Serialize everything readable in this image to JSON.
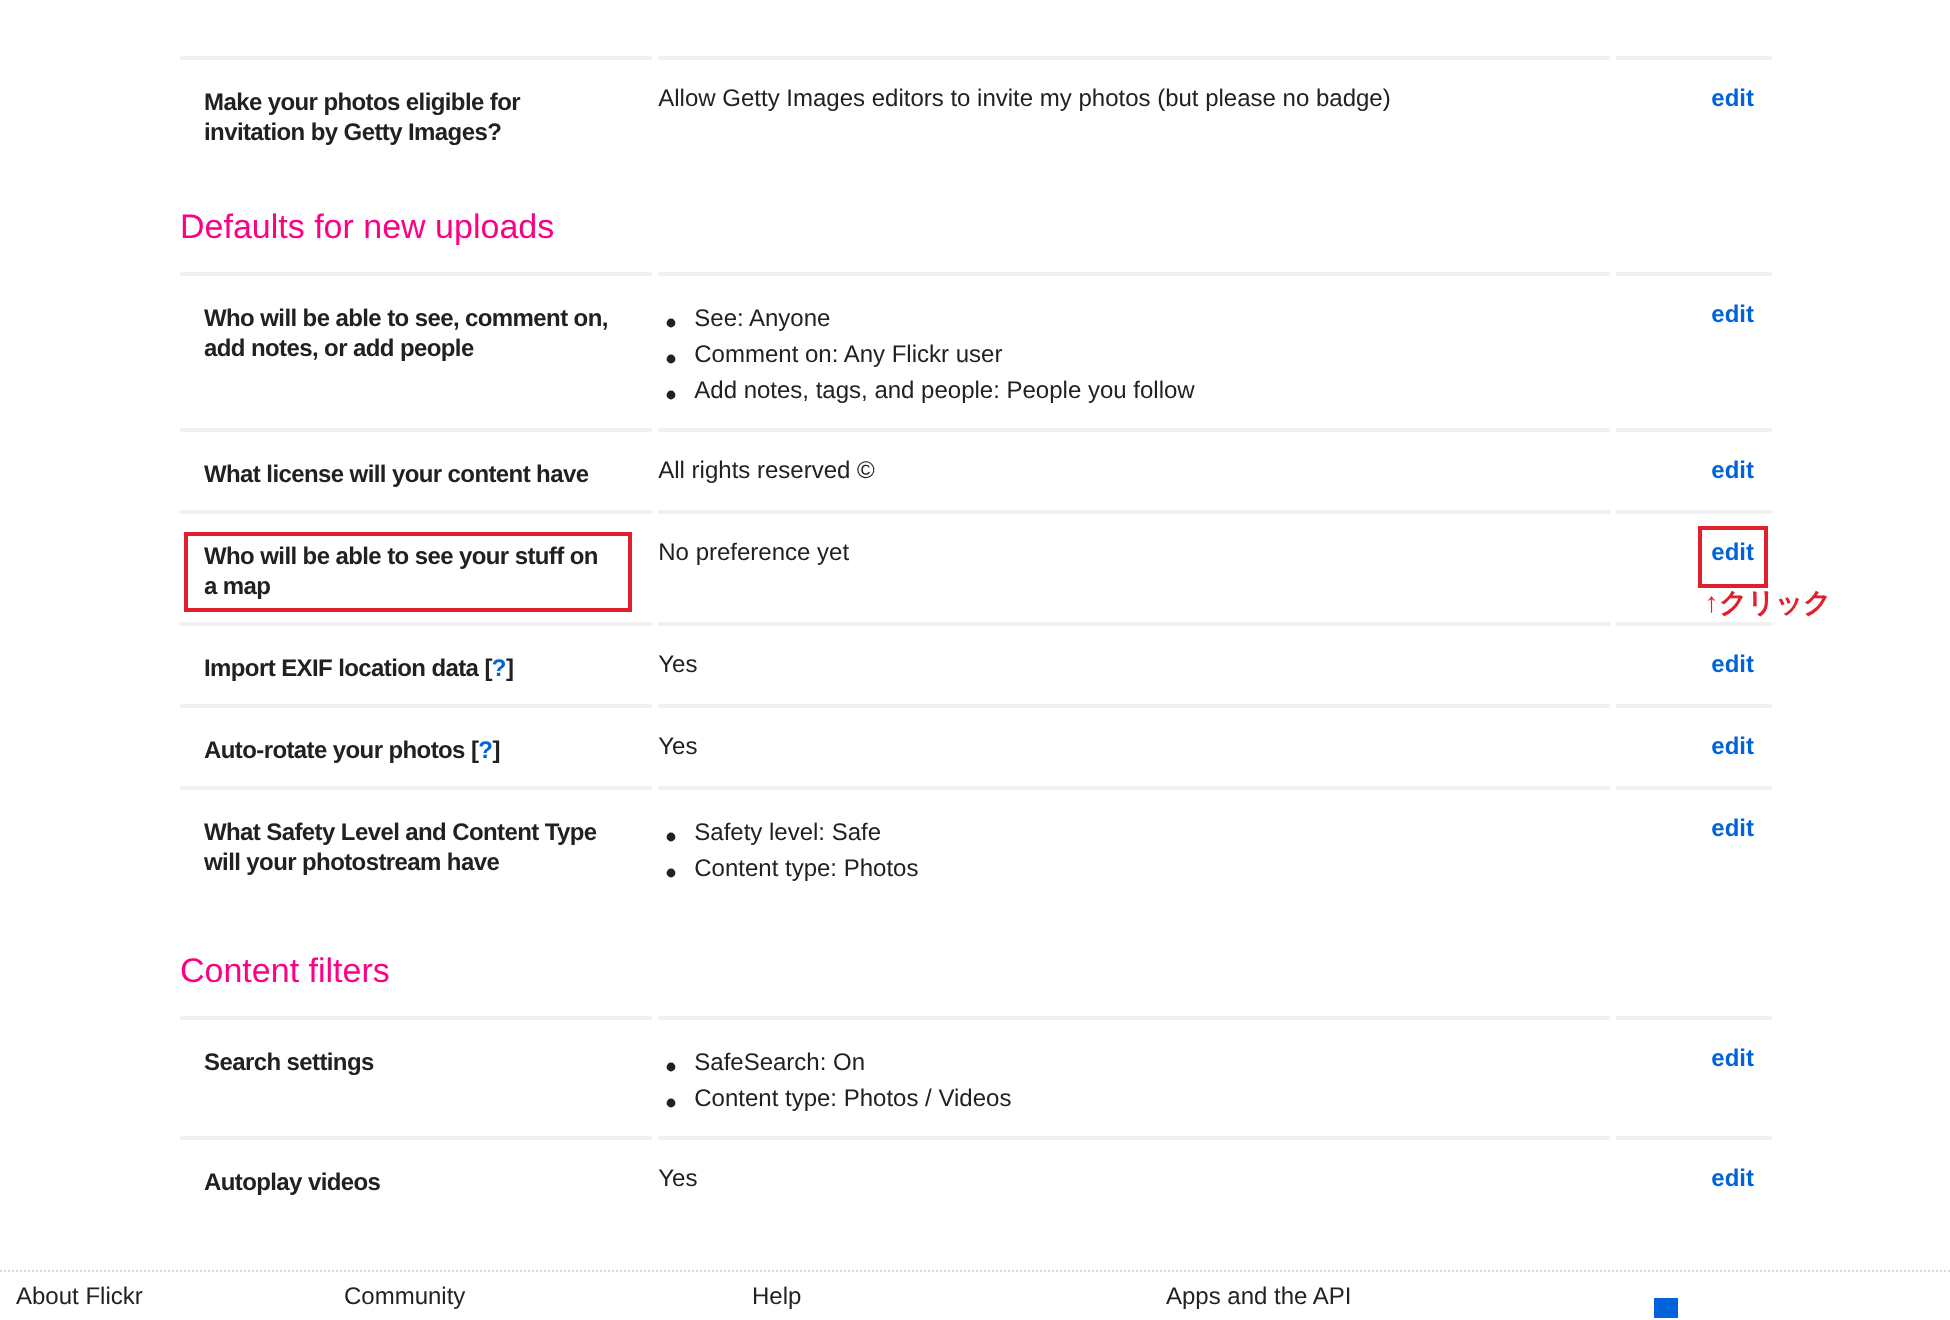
{
  "sections": [
    {
      "rows": [
        {
          "label": "Make your photos eligible for invitation by Getty Images?",
          "kind": "text",
          "value": "Allow Getty Images editors to invite my photos (but please no badge)",
          "edit": "edit",
          "label_highlighted": false,
          "edit_highlighted": false
        }
      ]
    },
    {
      "heading": "Defaults for new uploads",
      "rows": [
        {
          "label": "Who will be able to see, comment on, add notes, or add people",
          "kind": "list",
          "items": [
            "See: Anyone",
            "Comment on: Any Flickr user",
            "Add notes, tags, and people: People you follow"
          ],
          "edit": "edit",
          "label_highlighted": false,
          "edit_highlighted": false
        },
        {
          "label": "What license will your content have",
          "kind": "text",
          "value": "All rights reserved ©",
          "edit": "edit",
          "label_highlighted": false,
          "edit_highlighted": false
        },
        {
          "label": "Who will be able to see your stuff on a map",
          "kind": "text",
          "value": "No preference yet",
          "edit": "edit",
          "label_highlighted": true,
          "edit_highlighted": true,
          "annotation": "↑クリック"
        },
        {
          "label": "Import EXIF location data ",
          "help_open": "[",
          "help": "?",
          "help_close": "]",
          "kind": "text",
          "value": "Yes",
          "edit": "edit",
          "label_highlighted": false,
          "edit_highlighted": false
        },
        {
          "label": "Auto-rotate your photos ",
          "help_open": "[",
          "help": "?",
          "help_close": "]",
          "kind": "text",
          "value": "Yes",
          "edit": "edit",
          "label_highlighted": false,
          "edit_highlighted": false
        },
        {
          "label": "What Safety Level and Content Type will your photostream have",
          "kind": "list",
          "items": [
            "Safety level: Safe",
            "Content type: Photos"
          ],
          "edit": "edit",
          "label_highlighted": false,
          "edit_highlighted": false
        }
      ]
    },
    {
      "heading": "Content filters",
      "rows": [
        {
          "label": "Search settings",
          "kind": "list",
          "items": [
            "SafeSearch: On",
            "Content type: Photos / Videos"
          ],
          "edit": "edit",
          "label_highlighted": false,
          "edit_highlighted": false
        },
        {
          "label": "Autoplay videos",
          "kind": "text",
          "value": "Yes",
          "edit": "edit",
          "label_highlighted": false,
          "edit_highlighted": false
        }
      ]
    }
  ],
  "footer": {
    "columns": [
      "About Flickr",
      "Community",
      "Help",
      "Apps and the API"
    ]
  }
}
